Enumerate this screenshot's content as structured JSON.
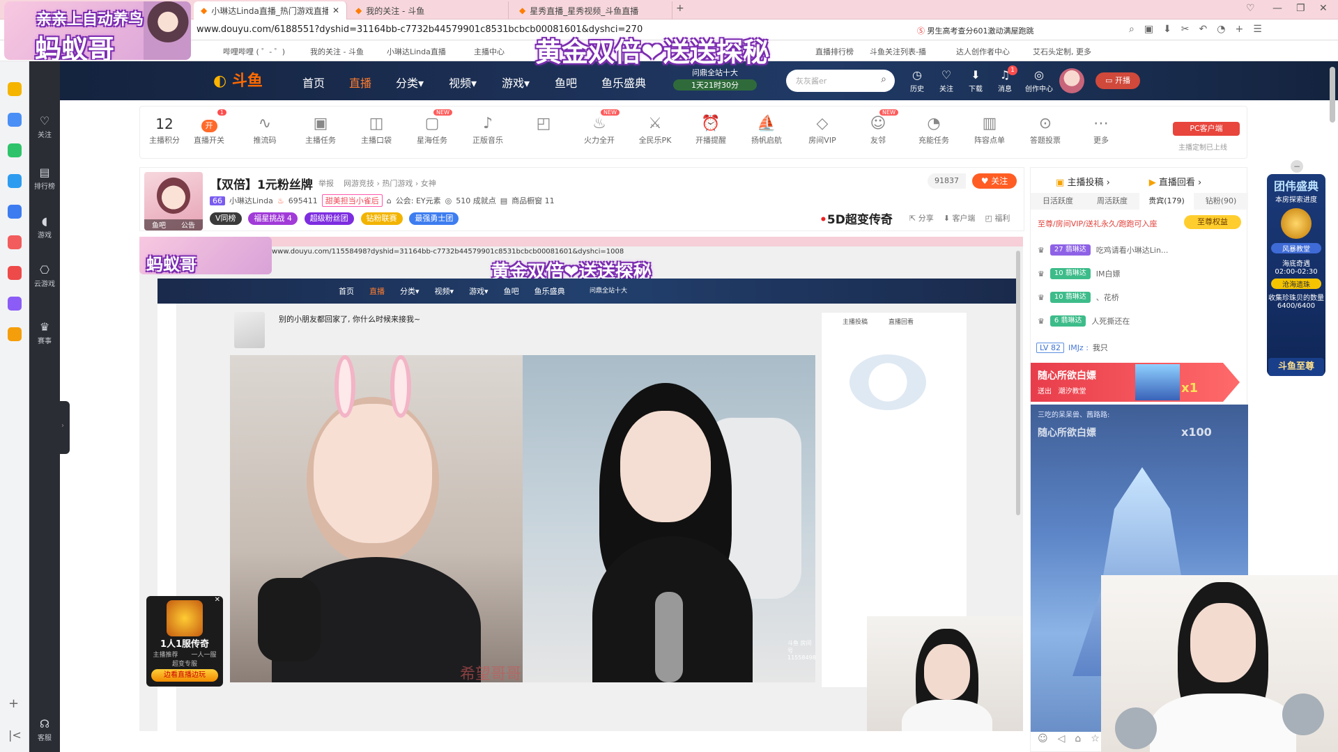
{
  "browser": {
    "tabs": [
      {
        "label": "小琳达Linda直播_热门游戏直播_斗鱼",
        "active": true
      },
      {
        "label": "我的关注 - 斗鱼",
        "active": false
      },
      {
        "label": "星秀直播_星秀视频_斗鱼直播",
        "active": false
      }
    ],
    "new_tab": "+",
    "url": "www.douyu.com/6188551?dyshid=31164bb-c7732b44579901c8531bcbcb00081601&dyshci=270",
    "search_hint": "男生高考查分601激动满屋跑跳",
    "bookmarks": [
      "哔哩哔哩 ( ゜- ゜)",
      "我的关注 - 斗鱼",
      "小琳达Linda直播",
      "主播中心",
      "斗鱼关注列表-播",
      "达人创作者中心",
      "艾石头定制, 更多"
    ],
    "bookmark_right": "直播排行榜"
  },
  "overlay": {
    "top_left_line1": "亲亲上自动养鸟",
    "top_left_line2": "蚂蚁哥",
    "banner": "黄金双倍❤送送探秘"
  },
  "sidenav": [
    "关注",
    "排行榜",
    "游戏",
    "云游戏",
    "赛事",
    "客服"
  ],
  "header": {
    "logo": "斗鱼",
    "nav": [
      "首页",
      "直播",
      "分类▾",
      "视频▾",
      "游戏▾",
      "鱼吧",
      "鱼乐盛典"
    ],
    "event_line1": "问鼎全站十大",
    "event_line2": "1天21时30分",
    "search_placeholder": "灰灰酱er",
    "icons": [
      "历史",
      "关注",
      "下载",
      "消息",
      "创作中心"
    ],
    "msg_count": "1",
    "live_btn": "开播"
  },
  "toolbar": {
    "score": "12",
    "score_label": "主播积分",
    "live_toggle": "开",
    "live_toggle_count": "1",
    "items": [
      "直播开关",
      "推流码",
      "主播任务",
      "主播口袋",
      "星海任务",
      "正版音乐",
      "礼物",
      "火力全开",
      "全民乐PK",
      "开播提醒",
      "扬帆启航",
      "房间VIP",
      "友邻",
      "充能任务",
      "阵容点单",
      "答题投票",
      "更多"
    ],
    "new_items": [
      "星海任务",
      "火力全开",
      "友邻"
    ],
    "pc_client": "PC客户端",
    "pc_sub": "主播定制已上线"
  },
  "room": {
    "title": "【双倍】1元粉丝牌",
    "report": "举报",
    "category": "网游竞技 › 热门游戏 › 女神",
    "level": "66",
    "anchor": "小琳达Linda",
    "hot": "695411",
    "tag": "甜美担当小雀后",
    "guild": "公会: EY元素",
    "achievements": "510 成就点",
    "shop": "商品橱窗 11",
    "avatar_tabs": [
      "鱼吧",
      "公告"
    ],
    "pills": [
      "V同榜",
      "福星挑战 4",
      "超级粉丝团",
      "钻粉联赛",
      "最强勇士团"
    ],
    "followers": "91837",
    "follow_btn": "关注",
    "legend": "5D超变传奇",
    "actions": [
      "分享",
      "客户端",
      "福利"
    ]
  },
  "inner": {
    "url": "www.douyu.com/11558498?dyshid=31164bb-c7732b44579901c8531bcbcb00081601&dyshci=1008",
    "room_title": "别的小朋友都回家了, 你什么时候来接我~",
    "nav": [
      "首页",
      "直播",
      "分类▾",
      "视频▾",
      "游戏▾",
      "鱼吧",
      "鱼乐盛典"
    ],
    "event": "问鼎全站十大",
    "banner": "黄金双倍❤送送探秘",
    "watermark": "希望哥哥",
    "right_tabs": [
      "主播投稿",
      "直播回看"
    ],
    "room_id_badge": "斗鱼 房间号 11558498"
  },
  "ad": {
    "title": "1人1服传奇",
    "tags": [
      "主播推荐",
      "一人一服"
    ],
    "sub": "超变专服",
    "btn": "边看直播边玩"
  },
  "rightpanel": {
    "tabs_top": [
      "主播投稿 ›",
      "直播回看 ›"
    ],
    "rank_tabs": [
      "日活跃度",
      "周活跃度",
      "贵宾(179)",
      "钻粉(90)"
    ],
    "vip_text": "至尊/房间VIP/送礼永久/跑跑可入座",
    "vip_btn": "至尊权益",
    "rows": [
      {
        "badge": "27 翡琳达",
        "text": "吃鸡请看小琳达Lin..."
      },
      {
        "badge": "10 翡琳达",
        "text": "IM白嫖"
      },
      {
        "badge": "10 翡琳达",
        "text": "、花桥"
      },
      {
        "badge": "6 翡琳达",
        "text": "人死撕还在"
      }
    ],
    "lv_badge": "LV 82",
    "chat_user": "IMJz :",
    "chat_text": "我只",
    "gift_title": "随心所欲白嫖",
    "gift_from": "送出",
    "gift_to": "潮汐教堂",
    "gift_count": "x1",
    "gift2_title": "随心所欲白嫖",
    "gift2_count": "x100",
    "gift2_from": "三吃的呆呆兽、茜路路:"
  },
  "floating": {
    "title": "团伟盛典",
    "sub": "本房探索进度",
    "label": "风暴教堂",
    "time_title": "海底奇遇",
    "time": "02:00-02:30",
    "note": "沧海遗珠",
    "progress_label": "收集珍珠贝的数量",
    "progress": "6400/6400",
    "footer": "斗鱼至尊"
  }
}
